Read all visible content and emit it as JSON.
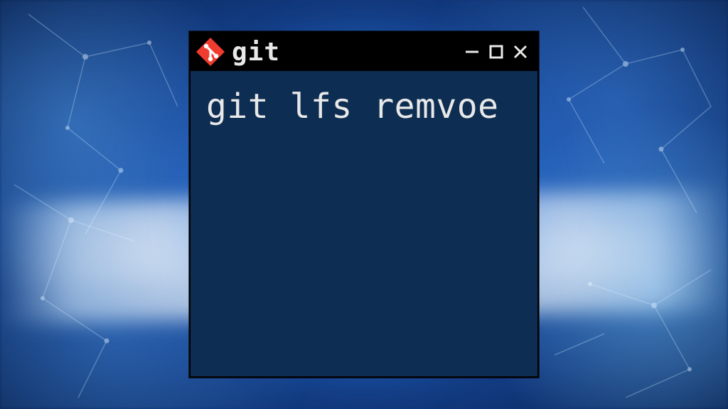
{
  "window": {
    "title": "git",
    "logo_name": "git-logo-icon",
    "controls": {
      "minimize_name": "minimize-icon",
      "maximize_name": "maximize-icon",
      "close_name": "close-icon"
    }
  },
  "terminal": {
    "command": "git lfs remvoe"
  },
  "colors": {
    "terminal_bg": "#0d2d52",
    "titlebar_bg": "#000000",
    "text": "#e8e8e8",
    "git_logo_bg": "#f03c2e"
  }
}
